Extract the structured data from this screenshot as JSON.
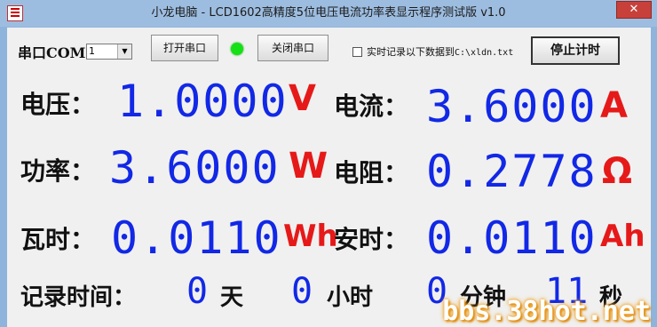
{
  "window": {
    "title": "小龙电脑 - LCD1602高精度5位电压电流功率表显示程序测试版 v1.0",
    "close_label": "✕"
  },
  "toolbar": {
    "com_label": "串口COM",
    "com_selected": "1",
    "open_port_label": "打开串口",
    "close_port_label": "关闭串口",
    "record_label": "实时记录以下数据到",
    "record_path": "C:\\xldn.txt",
    "stop_timer_label": "停止计时",
    "led_color": "#16e016"
  },
  "readings": {
    "voltage": {
      "label": "电压：",
      "value": "1.0000",
      "unit": "V"
    },
    "current": {
      "label": "电流：",
      "value": "3.6000",
      "unit": "A"
    },
    "power": {
      "label": "功率：",
      "value": "3.6000",
      "unit": "W"
    },
    "resistance": {
      "label": "电阻：",
      "value": "0.2778",
      "unit": "Ω"
    },
    "watt_hours": {
      "label": "瓦时：",
      "value": "0.0110",
      "unit": "Wh"
    },
    "amp_hours": {
      "label": "安时：",
      "value": "0.0110",
      "unit": "Ah"
    }
  },
  "timer": {
    "label": "记录时间：",
    "days": "0",
    "days_unit": "天",
    "hours": "0",
    "hours_unit": "小时",
    "minutes": "0",
    "minutes_unit": "分钟",
    "seconds": "11",
    "seconds_unit": "秒"
  },
  "watermark": "bbs.38hot.net",
  "colors": {
    "digits": "#1228e6",
    "units": "#e61919"
  }
}
